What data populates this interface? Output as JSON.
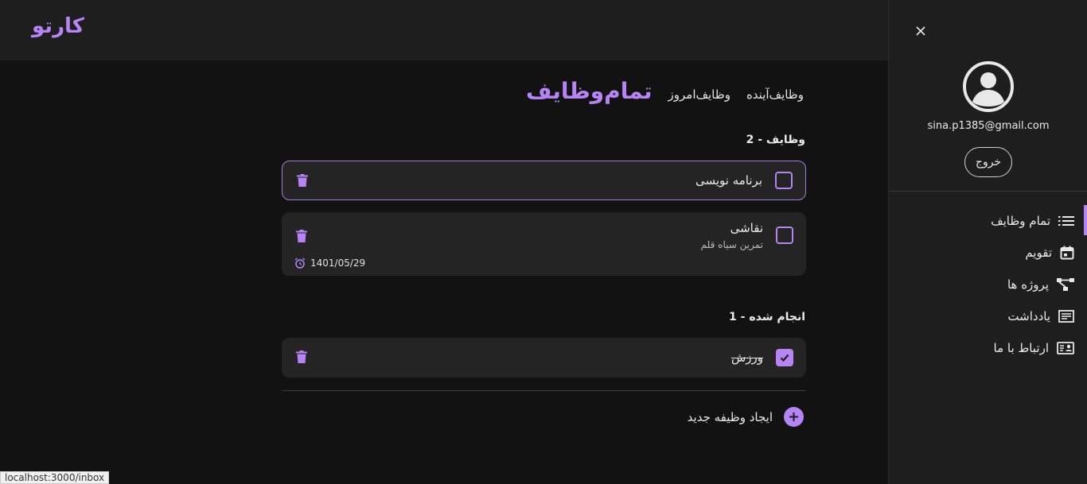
{
  "app": {
    "logo": "کارتو"
  },
  "tabs": {
    "all": "تمام‌وظایف",
    "today": "وظایف‌امروز",
    "upcoming": "وظایف‌آینده"
  },
  "sections": {
    "tasks_title": "وظایف - 2",
    "done_title": "انجام شده - 1"
  },
  "tasks": [
    {
      "title": "برنامه نویسی",
      "subtitle": "",
      "date": "",
      "done": false
    },
    {
      "title": "نقاشی",
      "subtitle": "تمرین سیاه قلم",
      "date": "1401/05/29",
      "done": false
    }
  ],
  "done_tasks": [
    {
      "title": "ورزش",
      "done": true
    }
  ],
  "new_task_label": "ایجاد وظیفه جدید",
  "sidebar": {
    "email": "sina.p1385@gmail.com",
    "logout": "خروج",
    "items": [
      {
        "label": "تمام وظایف",
        "icon": "list-icon"
      },
      {
        "label": "تقویم",
        "icon": "calendar-icon"
      },
      {
        "label": "پروژه ها",
        "icon": "project-icon"
      },
      {
        "label": "یادداشت",
        "icon": "note-icon"
      },
      {
        "label": "ارتباط با ما",
        "icon": "contact-icon"
      }
    ]
  },
  "status_bar": "localhost:3000/inbox",
  "colors": {
    "accent": "#b784f5",
    "background": "#121212",
    "surface": "#242424"
  }
}
